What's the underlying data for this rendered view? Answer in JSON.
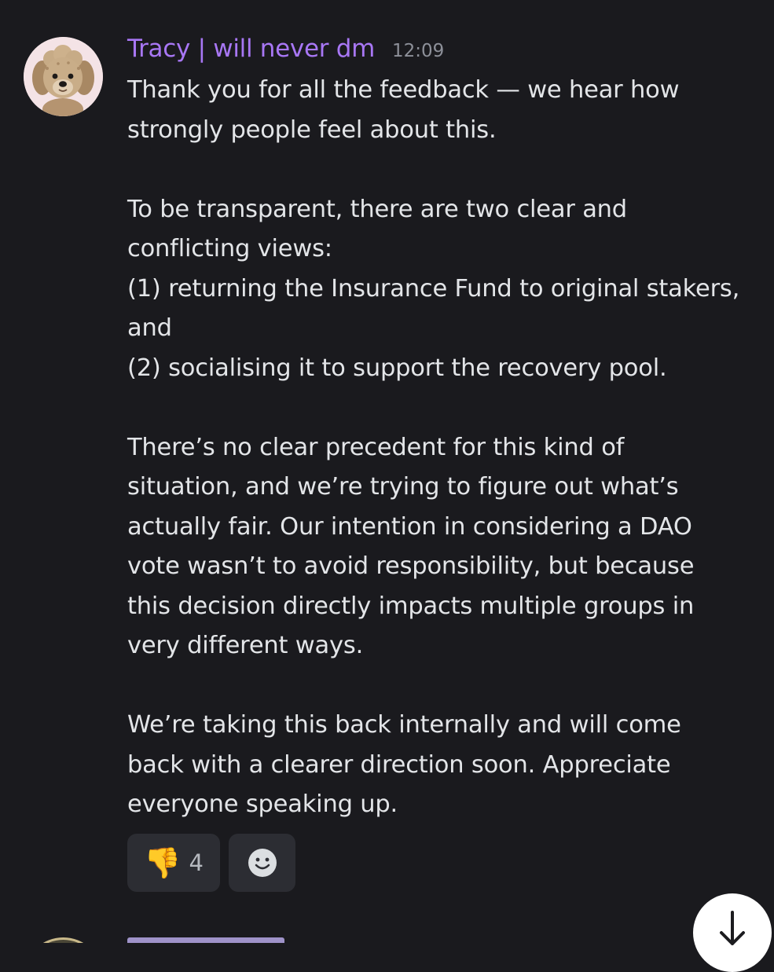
{
  "message": {
    "username": "Tracy | will never dm",
    "timestamp": "12:09",
    "paragraphs": [
      [
        "Thank you for all the feedback — we hear how",
        "strongly people feel about this."
      ],
      [
        "To be transparent, there are two clear and",
        "conflicting views:",
        "(1) returning the Insurance Fund to original stakers,",
        "and",
        "(2) socialising it to support the recovery pool."
      ],
      [
        "There’s no clear precedent for this kind of",
        "situation, and we’re trying to figure out what’s",
        "actually fair. Our intention in considering a DAO",
        "vote wasn’t to avoid responsibility, but because",
        "this decision directly impacts multiple groups in",
        "very different ways."
      ],
      [
        "We’re taking this back internally and will come",
        "back with a clearer direction soon. Appreciate",
        "everyone speaking up."
      ]
    ],
    "reactions": [
      {
        "emoji": "👎",
        "icon": "thumbs-down-icon",
        "count": "4"
      }
    ],
    "add_reaction_icon": "smiley-face-icon"
  },
  "scroll_button_icon": "arrow-down-icon",
  "colors": {
    "background": "#1a1a1e",
    "username": "#a877f5",
    "timestamp": "#8d9099",
    "text": "#e3e5e8",
    "reaction_bg": "#2c2d33"
  }
}
